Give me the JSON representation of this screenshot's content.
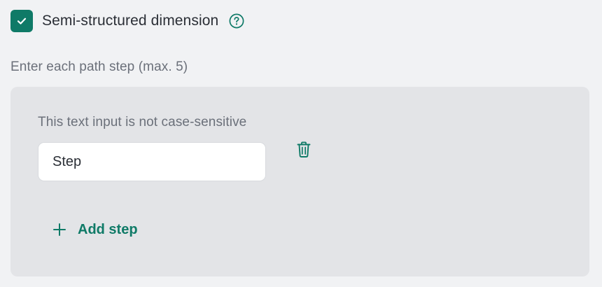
{
  "semi_structured": {
    "checked": true,
    "label": "Semi-structured dimension",
    "help_icon": "question-circle-icon"
  },
  "path_steps": {
    "label": "Enter each path step (max. 5)",
    "hint": "This text input is not case-sensitive",
    "steps": [
      {
        "value": "",
        "placeholder": "Step"
      }
    ],
    "delete_icon": "trash-icon",
    "add_label": "Add step",
    "add_icon": "plus-icon"
  },
  "colors": {
    "accent": "#0f7a67",
    "background": "#f1f2f4",
    "panel": "#e3e4e7",
    "text": "#2b2f36",
    "muted_text": "#6b707a"
  }
}
